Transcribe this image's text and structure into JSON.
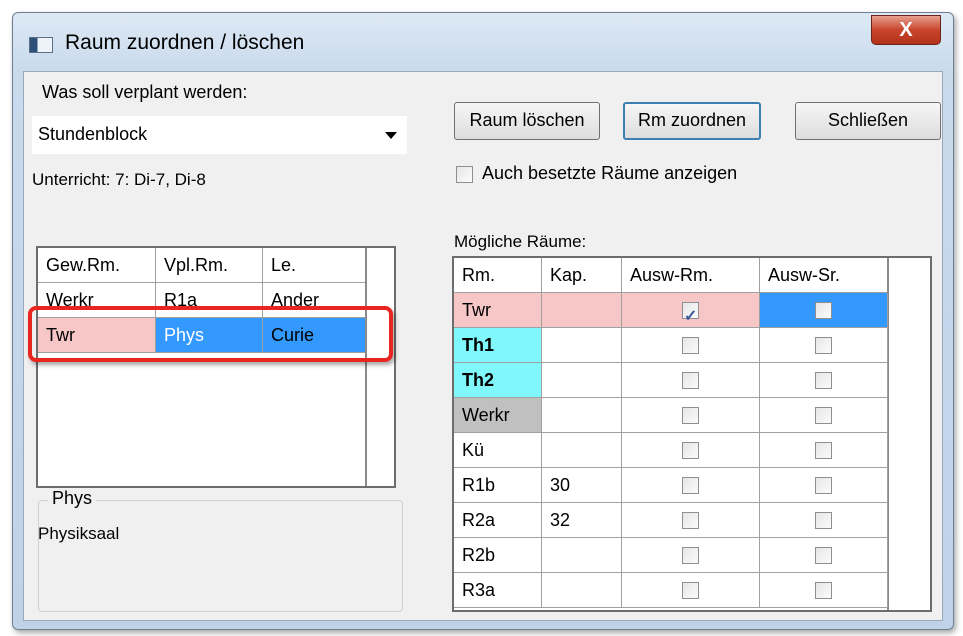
{
  "window": {
    "title": "Raum zuordnen / löschen",
    "close_label": "X"
  },
  "left": {
    "plan_label": "Was soll verplant werden:",
    "plan_value": "Stundenblock",
    "lesson_info": "Unterricht: 7: Di-7, Di-8",
    "table": {
      "headers": [
        "Gew.Rm.",
        "Vpl.Rm.",
        "Le."
      ],
      "rows": [
        [
          "Werkr",
          "R1a",
          "Ander"
        ],
        [
          "Twr",
          "Phys",
          "Curie"
        ]
      ]
    },
    "group": {
      "title": "Phys",
      "text": "Physiksaal"
    }
  },
  "right": {
    "buttons": {
      "delete": "Raum löschen",
      "assign": "Rm zuordnen",
      "close": "Schließen"
    },
    "show_occupied": {
      "label": "Auch besetzte Räume anzeigen",
      "checked": false
    },
    "rooms_label": "Mögliche Räume:",
    "table": {
      "headers": [
        "Rm.",
        "Kap.",
        "Ausw-Rm.",
        "Ausw-Sr."
      ],
      "rows": [
        {
          "rm": "Twr",
          "kap": "",
          "ausw_rm": true,
          "ausw_sr": false
        },
        {
          "rm": "Th1",
          "kap": "",
          "ausw_rm": false,
          "ausw_sr": false
        },
        {
          "rm": "Th2",
          "kap": "",
          "ausw_rm": false,
          "ausw_sr": false
        },
        {
          "rm": "Werkr",
          "kap": "",
          "ausw_rm": false,
          "ausw_sr": false
        },
        {
          "rm": "Kü",
          "kap": "",
          "ausw_rm": false,
          "ausw_sr": false
        },
        {
          "rm": "R1b",
          "kap": "30",
          "ausw_rm": false,
          "ausw_sr": false
        },
        {
          "rm": "R2a",
          "kap": "32",
          "ausw_rm": false,
          "ausw_sr": false
        },
        {
          "rm": "R2b",
          "kap": "",
          "ausw_rm": false,
          "ausw_sr": false
        },
        {
          "rm": "R3a",
          "kap": "",
          "ausw_rm": false,
          "ausw_sr": false
        }
      ]
    }
  },
  "colors": {
    "pink_row": "#f7c6c6",
    "selected_blue": "#3399ff",
    "cyan_cell": "#7ff7fb",
    "gray_cell": "#c0c0c0",
    "highlight_red": "#e8261f"
  },
  "icons": {
    "window_icon": "window-icon",
    "close": "close-icon",
    "dropdown": "chevron-down-icon",
    "checkbox": "checkbox-icon"
  }
}
